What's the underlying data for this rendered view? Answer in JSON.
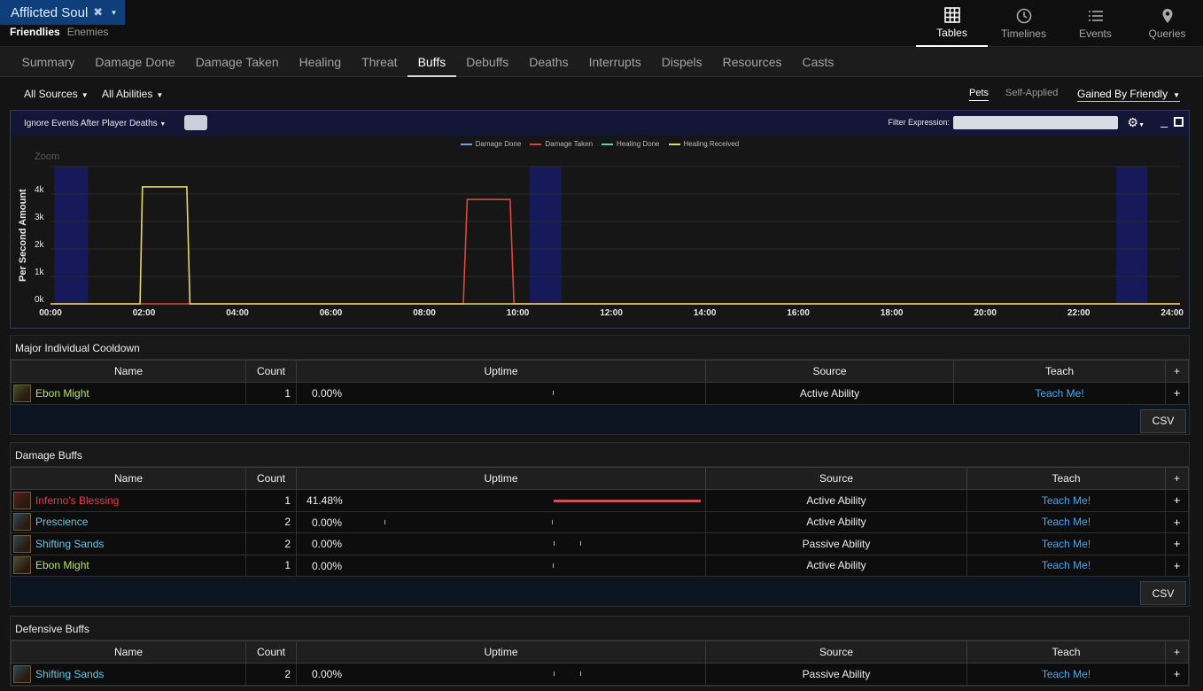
{
  "fight": {
    "name": "Afflicted Soul",
    "close_glyph": "✖",
    "caret": "▾"
  },
  "side_tabs": [
    "Friendlies",
    "Enemies"
  ],
  "top_nav": [
    {
      "label": "Tables",
      "icon": "grid-icon"
    },
    {
      "label": "Timelines",
      "icon": "clock-icon"
    },
    {
      "label": "Events",
      "icon": "list-icon"
    },
    {
      "label": "Queries",
      "icon": "map-pin-icon"
    }
  ],
  "tabs": [
    "Summary",
    "Damage Done",
    "Damage Taken",
    "Healing",
    "Threat",
    "Buffs",
    "Debuffs",
    "Deaths",
    "Interrupts",
    "Dispels",
    "Resources",
    "Casts"
  ],
  "active_tab": "Buffs",
  "filters": {
    "sources": "All Sources",
    "abilities": "All Abilities",
    "pets": "Pets",
    "self_applied": "Self-Applied",
    "gained_by": "Gained By Friendly"
  },
  "graph": {
    "ignore_deaths": "Ignore Events After Player Deaths",
    "filter_label": "Filter Expression:",
    "filter_value": "",
    "zoom_label": "Zoom"
  },
  "chart_data": {
    "type": "line",
    "ylabel": "Per Second Amount",
    "xlabel": "",
    "x_ticks": [
      "00:00",
      "02:00",
      "04:00",
      "06:00",
      "08:00",
      "10:00",
      "12:00",
      "14:00",
      "16:00",
      "18:00",
      "20:00",
      "22:00",
      "24:00"
    ],
    "y_ticks": [
      "0k",
      "1k",
      "2k",
      "3k",
      "4k"
    ],
    "ylim": [
      0,
      5000
    ],
    "xlim_seconds": [
      0,
      1450
    ],
    "series": [
      {
        "name": "Damage Done",
        "color": "#6aa4e8",
        "points": []
      },
      {
        "name": "Damage Taken",
        "color": "#e0443c",
        "points": [
          [
            0,
            0
          ],
          [
            530,
            0
          ],
          [
            535,
            3800
          ],
          [
            590,
            3800
          ],
          [
            595,
            0
          ],
          [
            1450,
            0
          ]
        ]
      },
      {
        "name": "Healing Done",
        "color": "#4fd8a0",
        "points": []
      },
      {
        "name": "Healing Received",
        "color": "#e6d66a",
        "points": [
          [
            0,
            0
          ],
          [
            115,
            0
          ],
          [
            118,
            4260
          ],
          [
            175,
            4260
          ],
          [
            179,
            0
          ],
          [
            1450,
            0
          ]
        ]
      }
    ],
    "highlight_bands_seconds": [
      [
        5,
        48
      ],
      [
        615,
        656
      ],
      [
        1368,
        1408
      ]
    ],
    "grid": true,
    "legend": "top-center"
  },
  "sections": [
    {
      "title": "Major Individual Cooldown",
      "headers": [
        "Name",
        "Count",
        "Uptime",
        "Source",
        "Teach",
        "+"
      ],
      "rows": [
        {
          "name": "Ebon Might",
          "color": "#b5e267",
          "icon": "ebon-might-icon",
          "count": "1",
          "uptime": "0.00%",
          "uptime_frac": 0.0,
          "source": "Active Ability",
          "teach": "Teach Me!",
          "plus": "+"
        }
      ],
      "csv": "CSV"
    },
    {
      "title": "Damage Buffs",
      "headers": [
        "Name",
        "Count",
        "Uptime",
        "Source",
        "Teach",
        "+"
      ],
      "rows": [
        {
          "name": "Inferno's Blessing",
          "color": "#e0414b",
          "icon": "infernos-blessing-icon",
          "count": "1",
          "uptime": "41.48%",
          "uptime_frac": 0.4148,
          "source": "Active Ability",
          "teach": "Teach Me!",
          "plus": "+"
        },
        {
          "name": "Prescience",
          "color": "#63c9ea",
          "icon": "prescience-icon",
          "count": "2",
          "uptime": "0.00%",
          "uptime_frac": 0.0,
          "source": "Active Ability",
          "teach": "Teach Me!",
          "plus": "+"
        },
        {
          "name": "Shifting Sands",
          "color": "#63c9ea",
          "icon": "shifting-sands-icon",
          "count": "2",
          "uptime": "0.00%",
          "uptime_frac": 0.0,
          "source": "Passive Ability",
          "teach": "Teach Me!",
          "plus": "+"
        },
        {
          "name": "Ebon Might",
          "color": "#b5e267",
          "icon": "ebon-might-icon",
          "count": "1",
          "uptime": "0.00%",
          "uptime_frac": 0.0,
          "source": "Active Ability",
          "teach": "Teach Me!",
          "plus": "+"
        }
      ],
      "csv": "CSV"
    },
    {
      "title": "Defensive Buffs",
      "headers": [
        "Name",
        "Count",
        "Uptime",
        "Source",
        "Teach",
        "+"
      ],
      "rows": [
        {
          "name": "Shifting Sands",
          "color": "#63c9ea",
          "icon": "shifting-sands-icon",
          "count": "2",
          "uptime": "0.00%",
          "uptime_frac": 0.0,
          "source": "Passive Ability",
          "teach": "Teach Me!",
          "plus": "+"
        }
      ]
    }
  ]
}
